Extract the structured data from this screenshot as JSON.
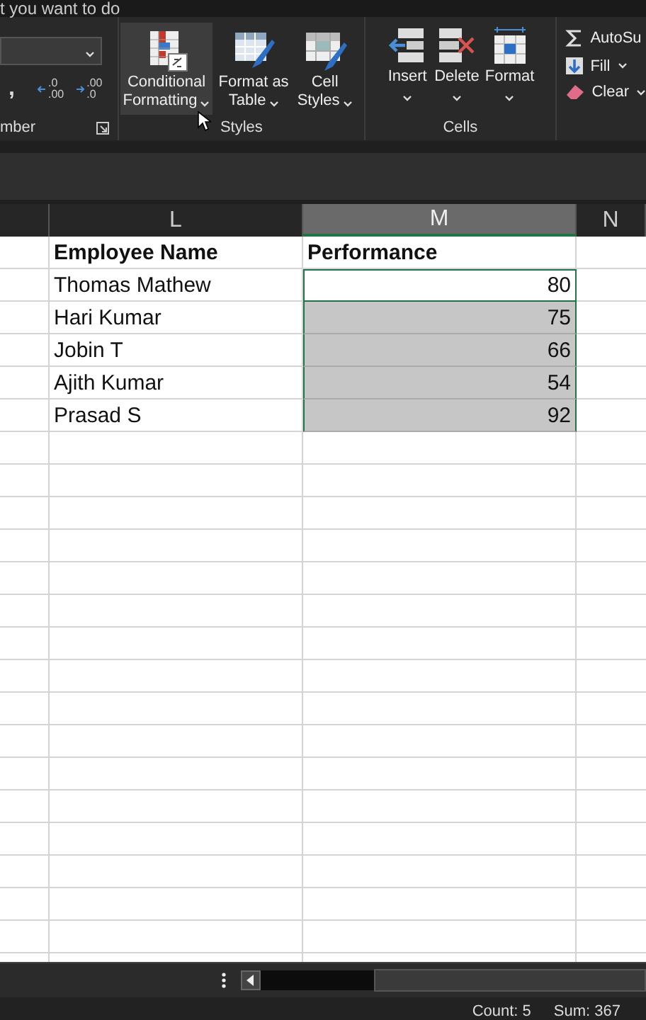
{
  "tell_me": {
    "placeholder": "t you want to do"
  },
  "ribbon": {
    "number_group": {
      "label": "mber",
      "comma": ",",
      "decimals": [
        {
          "kind": "increase",
          "top": ".0",
          "bottom": ".00"
        },
        {
          "kind": "decrease",
          "top": ".00",
          "bottom": ".0"
        }
      ]
    },
    "styles_group": {
      "label": "Styles",
      "buttons": [
        {
          "kind": "conditional",
          "line1": "Conditional",
          "line2": "Formatting",
          "hovered": true
        },
        {
          "kind": "table",
          "line1": "Format as",
          "line2": "Table",
          "hovered": false
        },
        {
          "kind": "cellstyles",
          "line1": "Cell",
          "line2": "Styles",
          "hovered": false
        }
      ]
    },
    "cells_group": {
      "label": "Cells",
      "buttons": [
        {
          "kind": "insert",
          "label": "Insert"
        },
        {
          "kind": "delete",
          "label": "Delete"
        },
        {
          "kind": "format",
          "label": "Format"
        }
      ]
    },
    "editing_group": {
      "items": [
        {
          "kind": "sum",
          "label": "AutoSu",
          "dropdown": false
        },
        {
          "kind": "fill",
          "label": "Fill",
          "dropdown": true
        },
        {
          "kind": "clear",
          "label": "Clear",
          "dropdown": true
        }
      ]
    }
  },
  "sheet": {
    "columns": [
      {
        "selected": false
      },
      {
        "label": "L",
        "selected": false
      },
      {
        "label": "M",
        "selected": true
      },
      {
        "label": "N",
        "selected": false
      }
    ],
    "header": {
      "name": "Employee Name",
      "value": "Performance"
    },
    "rows": [
      {
        "name": "Thomas Mathew",
        "value": "80",
        "selected": true,
        "active": true
      },
      {
        "name": "Hari Kumar",
        "value": "75",
        "selected": true,
        "active": false
      },
      {
        "name": "Jobin T",
        "value": "66",
        "selected": true,
        "active": false
      },
      {
        "name": "Ajith Kumar",
        "value": "54",
        "selected": true,
        "active": false
      },
      {
        "name": "Prasad S",
        "value": "92",
        "selected": true,
        "active": false
      }
    ]
  },
  "status_bar": {
    "count": "Count: 5",
    "sum": "Sum: 367"
  }
}
